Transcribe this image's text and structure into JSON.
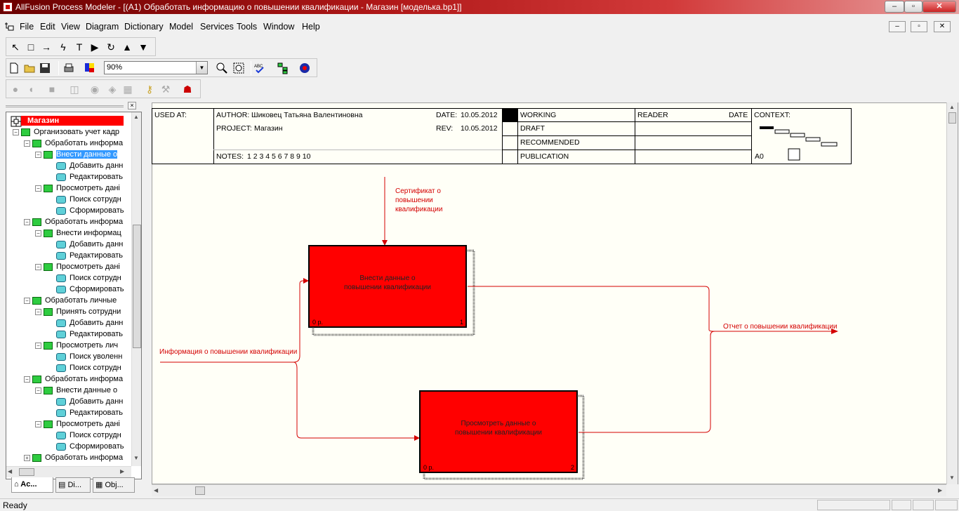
{
  "window": {
    "title": "AllFusion Process Modeler - [(A1) Обработать информацию  о повышении квалификации   - Магазин  [моделька.bp1]]",
    "min": "–",
    "max": "▫",
    "close": "✕"
  },
  "menu": [
    "File",
    "Edit",
    "View",
    "Diagram",
    "Dictionary",
    "Model",
    "Services",
    "Tools",
    "Window",
    "Help"
  ],
  "toolbar": {
    "tools": [
      "↖",
      "□",
      "→",
      "ϟ",
      "T",
      "▶",
      "↻",
      "▲",
      "▼"
    ],
    "zoom_value": "90%"
  },
  "tree": {
    "root": "Магазин",
    "items": [
      {
        "label": "Организовать учет кадр",
        "level": 1,
        "kind": "act",
        "expander": "−"
      },
      {
        "label": "Обработать информа",
        "level": 2,
        "kind": "act",
        "expander": "−"
      },
      {
        "label": "Внести данные о",
        "level": 3,
        "kind": "act",
        "expander": "−",
        "selected": true
      },
      {
        "label": "Добавить данн",
        "level": 4,
        "kind": "leaf"
      },
      {
        "label": "Редактировать",
        "level": 4,
        "kind": "leaf"
      },
      {
        "label": "Просмотреть дані",
        "level": 3,
        "kind": "act",
        "expander": "−"
      },
      {
        "label": "Поиск сотрудн",
        "level": 4,
        "kind": "leaf"
      },
      {
        "label": "Сформировать",
        "level": 4,
        "kind": "leaf"
      },
      {
        "label": "Обработать информа",
        "level": 2,
        "kind": "act",
        "expander": "−"
      },
      {
        "label": "Внести информац",
        "level": 3,
        "kind": "act",
        "expander": "−"
      },
      {
        "label": "Добавить данн",
        "level": 4,
        "kind": "leaf"
      },
      {
        "label": "Редактировать",
        "level": 4,
        "kind": "leaf"
      },
      {
        "label": "Просмотреть дані",
        "level": 3,
        "kind": "act",
        "expander": "−"
      },
      {
        "label": "Поиск сотрудн",
        "level": 4,
        "kind": "leaf"
      },
      {
        "label": "Сформировать",
        "level": 4,
        "kind": "leaf"
      },
      {
        "label": "Обработать  личные",
        "level": 2,
        "kind": "act",
        "expander": "−"
      },
      {
        "label": "Принять сотрудни",
        "level": 3,
        "kind": "act",
        "expander": "−"
      },
      {
        "label": "Добавить данн",
        "level": 4,
        "kind": "leaf"
      },
      {
        "label": "Редактировать",
        "level": 4,
        "kind": "leaf"
      },
      {
        "label": "Просмотреть  лич",
        "level": 3,
        "kind": "act",
        "expander": "−"
      },
      {
        "label": "Поиск уволенн",
        "level": 4,
        "kind": "leaf"
      },
      {
        "label": "Поиск сотрудн",
        "level": 4,
        "kind": "leaf"
      },
      {
        "label": "Обработать информа",
        "level": 2,
        "kind": "act",
        "expander": "−"
      },
      {
        "label": "Внести данные  о",
        "level": 3,
        "kind": "act",
        "expander": "−"
      },
      {
        "label": "Добавить данн",
        "level": 4,
        "kind": "leaf"
      },
      {
        "label": "Редактировать",
        "level": 4,
        "kind": "leaf"
      },
      {
        "label": "Просмотреть дані",
        "level": 3,
        "kind": "act",
        "expander": "−"
      },
      {
        "label": "Поиск сотрудн",
        "level": 4,
        "kind": "leaf"
      },
      {
        "label": "Сформировать",
        "level": 4,
        "kind": "leaf"
      },
      {
        "label": "Обработать информа",
        "level": 2,
        "kind": "act",
        "expander": "+"
      }
    ],
    "tabs": [
      "Ac...",
      "Di...",
      "Obj..."
    ]
  },
  "frame": {
    "used_at": "USED AT:",
    "author_label": "AUTHOR:",
    "author": "Шиковец Татьяна Валентиновна",
    "project_label": "PROJECT:",
    "project": "Магазин",
    "date_label": "DATE:",
    "date": "10.05.2012",
    "rev_label": "REV:",
    "rev": "10.05.2012",
    "notes_label": "NOTES:",
    "notes": "1  2  3  4  5  6  7  8  9  10",
    "status": [
      "WORKING",
      "DRAFT",
      "RECOMMENDED",
      "PUBLICATION"
    ],
    "reader": "READER",
    "date_col": "DATE",
    "context": "CONTEXT:",
    "node": "A0"
  },
  "diagram": {
    "box1": {
      "name_line1": "Внести данные о",
      "name_line2": "повышении квалификации",
      "cost": "0 р.",
      "num": "1"
    },
    "box2": {
      "name_line1": "Просмотреть данные о",
      "name_line2": "повышении квалификации",
      "cost": "0 р.",
      "num": "2"
    },
    "control_label": [
      "Сертификат о",
      "повышении",
      "квалификации"
    ],
    "input_label": "Информация о повышении квалификации",
    "output_label": "Отчет о повышении квалификации"
  },
  "status_bar": {
    "text": "Ready"
  },
  "colors": {
    "box_fill": "#ff0000",
    "arrow": "#d40000",
    "selection": "#3399ff"
  }
}
